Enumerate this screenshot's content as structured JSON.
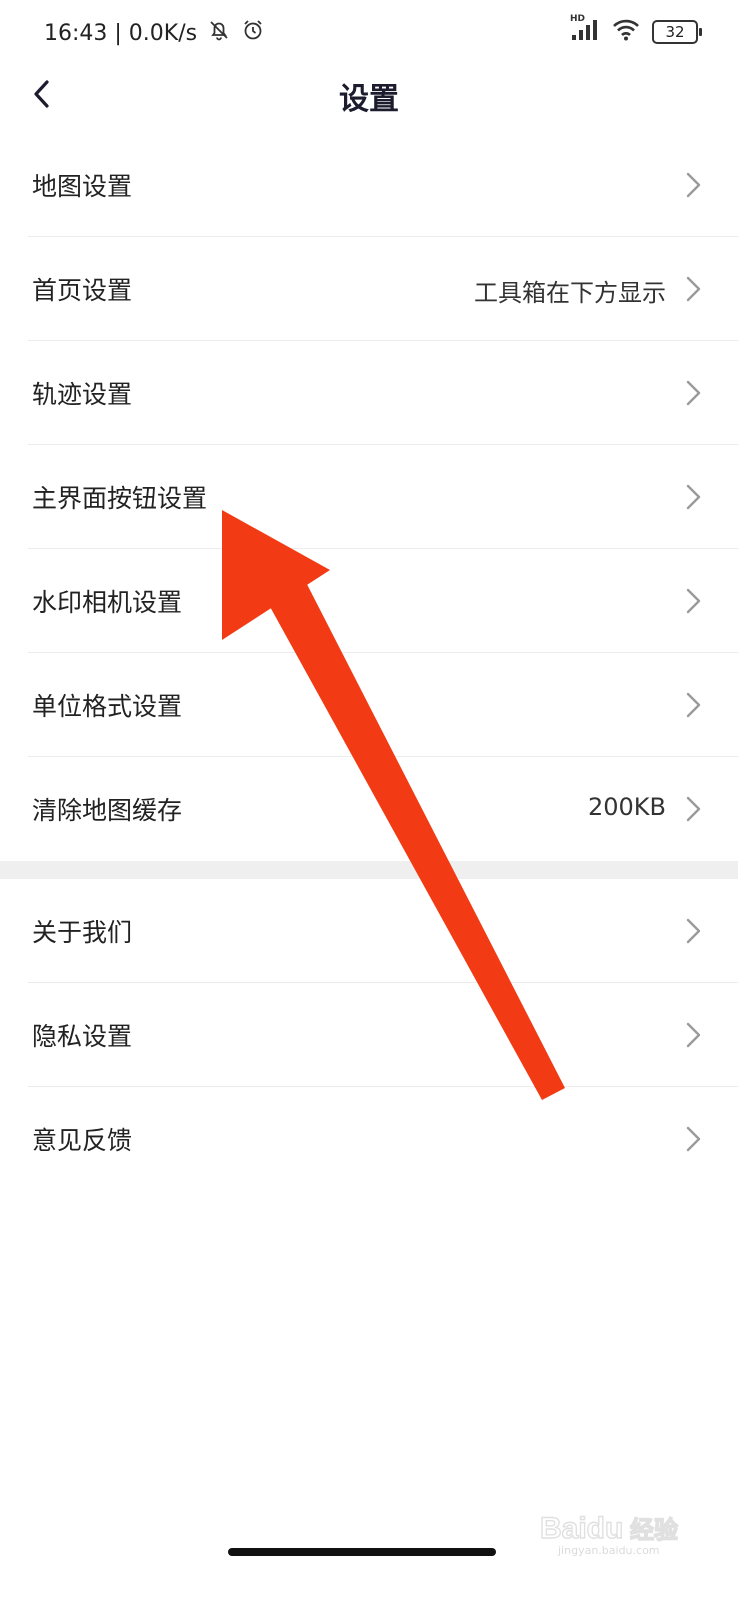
{
  "status_bar": {
    "time_speed": "16:43 | 0.0K/s",
    "network": "HD",
    "battery": "32"
  },
  "header": {
    "title": "设置"
  },
  "settings_group_1": [
    {
      "label": "地图设置",
      "value": ""
    },
    {
      "label": "首页设置",
      "value": "工具箱在下方显示"
    },
    {
      "label": "轨迹设置",
      "value": ""
    },
    {
      "label": "主界面按钮设置",
      "value": ""
    },
    {
      "label": "水印相机设置",
      "value": ""
    },
    {
      "label": "单位格式设置",
      "value": ""
    },
    {
      "label": "清除地图缓存",
      "value": "200KB"
    }
  ],
  "settings_group_2": [
    {
      "label": "关于我们",
      "value": ""
    },
    {
      "label": "隐私设置",
      "value": ""
    },
    {
      "label": "意见反馈",
      "value": ""
    }
  ],
  "watermark": {
    "brand": "Baidu经验",
    "site": "jingyan.baidu.com"
  },
  "colors": {
    "title": "#1c1c2e",
    "arrow": "#f23b14",
    "divider": "#ececec",
    "group_gap": "#efefef",
    "chevron": "#9a9a9a"
  }
}
